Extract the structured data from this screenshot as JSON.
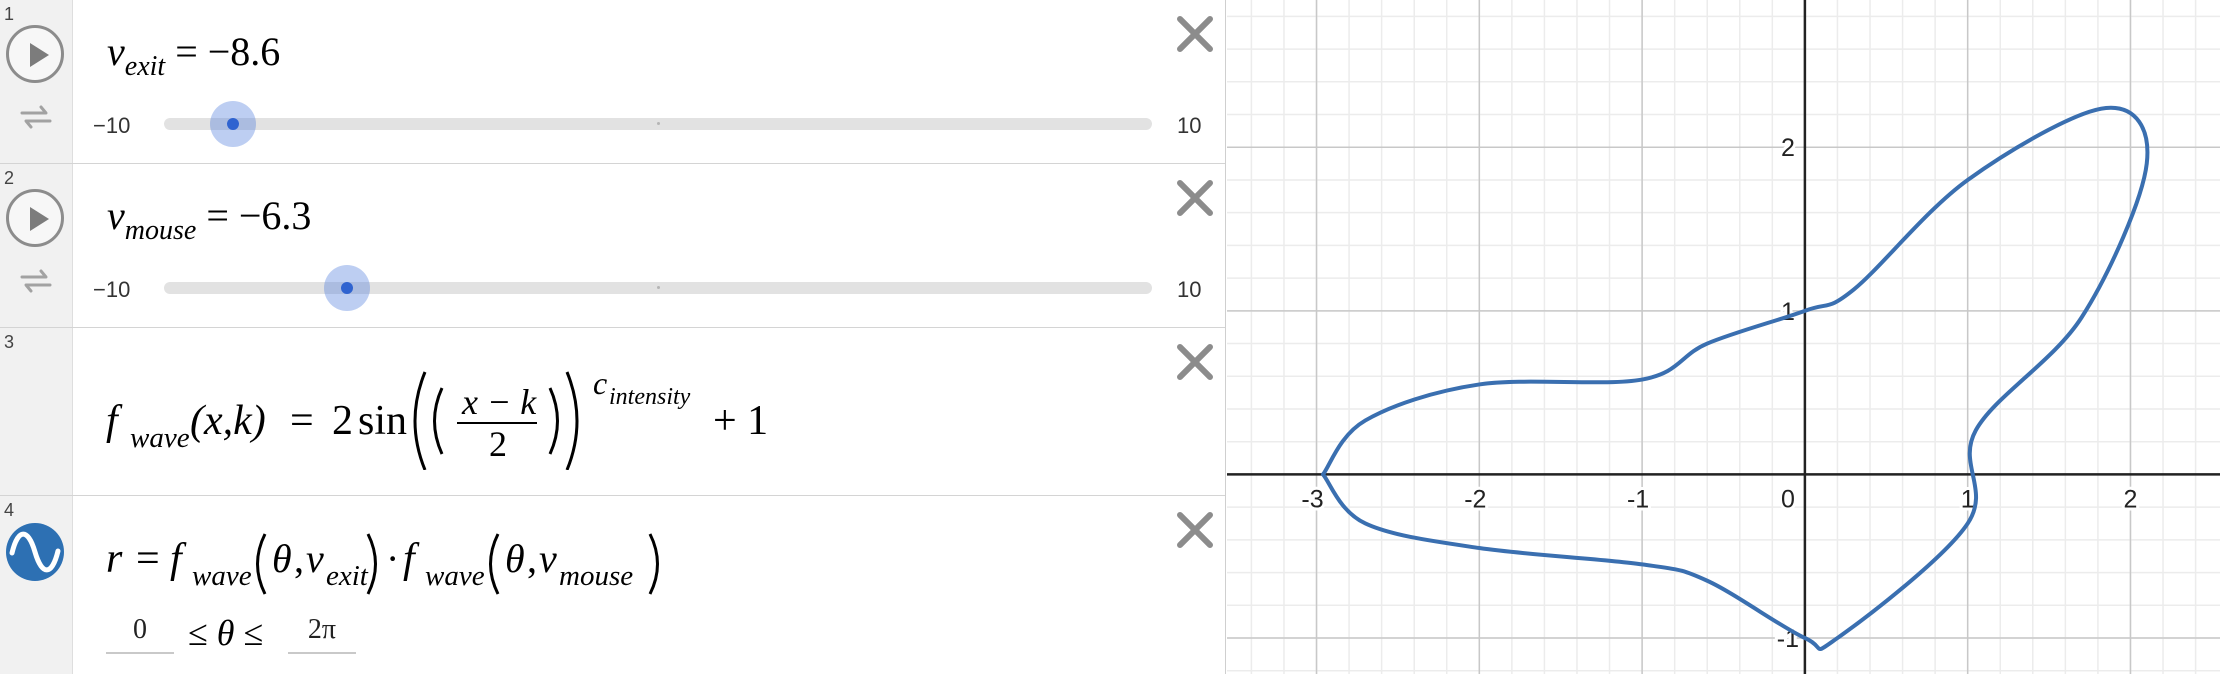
{
  "expressions": [
    {
      "index": "1",
      "var": "v",
      "sub": "exit",
      "eq": "=",
      "value": "−8.6",
      "slider": {
        "min_label": "−10",
        "max_label": "10",
        "min": -10,
        "max": 10,
        "value": -8.6
      }
    },
    {
      "index": "2",
      "var": "v",
      "sub": "mouse",
      "eq": "=",
      "value": "−6.3",
      "slider": {
        "min_label": "−10",
        "max_label": "10",
        "min": -10,
        "max": 10,
        "value": -6.3
      }
    },
    {
      "index": "3",
      "fname": "f",
      "fsub": "wave",
      "args": "(x,k)",
      "eq": "=",
      "coef": "2",
      "fn": "sin",
      "numer": "x − k",
      "denom": "2",
      "exp_base": "c",
      "exp_sub": "intensity",
      "tail": "+ 1"
    },
    {
      "index": "4",
      "lhs": "r",
      "eq": "=",
      "f": "f",
      "fsub": "wave",
      "theta": "θ",
      "arg1_var": "v",
      "arg1_sub": "exit",
      "dot": "·",
      "arg2_var": "v",
      "arg2_sub": "mouse",
      "domain_min": "0",
      "domain_max": "2π",
      "leq": "≤",
      "domain_var": "θ"
    }
  ],
  "icons": {
    "play": "play-icon",
    "loop": "loop-icon",
    "close": "close-icon",
    "wave": "desmos-wave-icon"
  },
  "graph": {
    "x_tick_labels": [
      "-3",
      "-2",
      "-1",
      "0",
      "1",
      "2"
    ],
    "y_tick_labels": [
      "2",
      "1",
      "-1"
    ],
    "curve_color": "#3a6fb0",
    "axis_color": "#222222",
    "grid_major": "#c8c8c8",
    "grid_minor": "#ececec",
    "x_range": [
      -3.55,
      2.55
    ],
    "y_range": [
      -1.22,
      2.9
    ],
    "curve_description_points": [
      [
        -2.96,
        -0.0
      ],
      [
        -2.7,
        0.33
      ],
      [
        -2.0,
        0.55
      ],
      [
        -1.0,
        0.58
      ],
      [
        -0.6,
        0.8
      ],
      [
        -0.0,
        1.0
      ],
      [
        0.3,
        1.13
      ],
      [
        1.0,
        1.8
      ],
      [
        1.85,
        2.24
      ],
      [
        2.1,
        1.9
      ],
      [
        1.7,
        0.96
      ],
      [
        1.05,
        0.27
      ],
      [
        1.0,
        -0.3
      ],
      [
        0.2,
        -1.0
      ],
      [
        -0.0,
        -1.0
      ],
      [
        -0.6,
        -0.65
      ],
      [
        -1.0,
        -0.55
      ],
      [
        -2.0,
        -0.45
      ],
      [
        -2.7,
        -0.3
      ],
      [
        -2.96,
        -0.0
      ]
    ]
  }
}
